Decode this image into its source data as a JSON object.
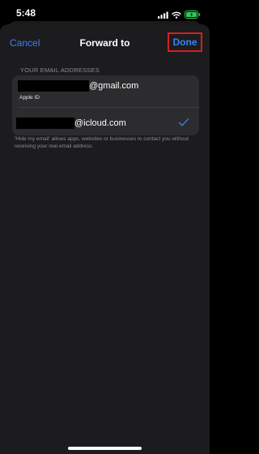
{
  "status_bar": {
    "time": "5:48",
    "icons": [
      "signal-icon",
      "wifi-icon",
      "battery-charging-icon"
    ],
    "battery_color": "#34c759"
  },
  "nav": {
    "cancel_label": "Cancel",
    "title": "Forward to",
    "done_label": "Done",
    "accent_color": "#3b82f6",
    "highlight_color": "#d61f1f"
  },
  "section": {
    "header": "YOUR EMAIL ADDRESSES"
  },
  "emails": [
    {
      "domain": "@gmail.com",
      "subtitle": "Apple ID",
      "selected": false
    },
    {
      "domain": "@icloud.com",
      "subtitle": "",
      "selected": true
    }
  ],
  "footer_note": "'Hide my email' allows apps, websites or businesses to contact you without receiving your real email address."
}
